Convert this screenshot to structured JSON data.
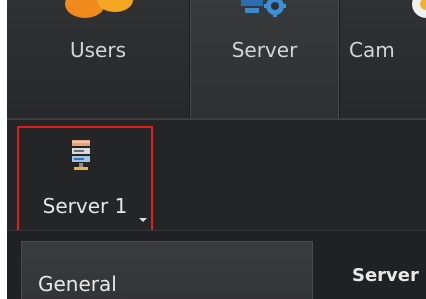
{
  "toolbar": {
    "items": [
      {
        "label": "Users",
        "icon": "users-icon"
      },
      {
        "label": "Server",
        "icon": "server-settings-icon"
      },
      {
        "label": "Cam",
        "icon": "camera-icon"
      }
    ]
  },
  "server_list": {
    "selected": {
      "label": "Server 1",
      "icon": "server-rack-icon"
    }
  },
  "settings": {
    "general_label": "General",
    "server_heading": "Server"
  },
  "colors": {
    "highlight": "#e01c1c",
    "background": "#1d1f21",
    "text": "#e6e6e6"
  }
}
